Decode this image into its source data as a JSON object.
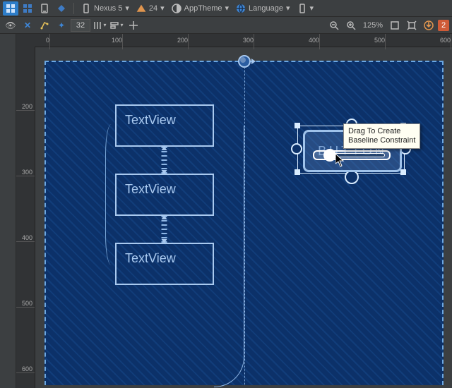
{
  "toolbar1": {
    "device": "Nexus 5",
    "api_level": "24",
    "theme": "AppTheme",
    "language": "Language"
  },
  "toolbar2": {
    "spacing_value": "32",
    "zoom_level": "125%",
    "notification_count": "2"
  },
  "ruler": {
    "h_ticks": [
      "0",
      "100",
      "200",
      "300",
      "400",
      "500",
      "600"
    ],
    "v_ticks": [
      "200",
      "300",
      "400",
      "500",
      "600"
    ]
  },
  "canvas": {
    "textviews": [
      {
        "label": "TextView"
      },
      {
        "label": "TextView"
      },
      {
        "label": "TextView"
      }
    ],
    "button_label": "BUTTON",
    "tooltip": "Drag To Create\nBaseline Constraint"
  }
}
